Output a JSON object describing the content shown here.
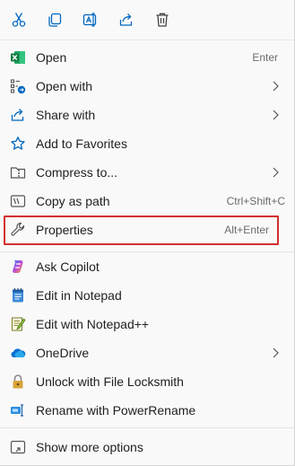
{
  "toolbar": {
    "cut_icon": "scissors-icon",
    "copy_icon": "copy-icon",
    "rename_icon": "rename-icon",
    "share_icon": "share-icon",
    "delete_icon": "trash-icon"
  },
  "items": [
    {
      "label": "Open",
      "shortcut": "Enter",
      "icon": "excel-icon"
    },
    {
      "label": "Open with",
      "shortcut": "",
      "icon": "open-with-icon",
      "submenu": true
    },
    {
      "label": "Share with",
      "shortcut": "",
      "icon": "share-with-icon",
      "submenu": true
    },
    {
      "label": "Add to Favorites",
      "shortcut": "",
      "icon": "star-icon"
    },
    {
      "label": "Compress to...",
      "shortcut": "",
      "icon": "zip-folder-icon",
      "submenu": true
    },
    {
      "label": "Copy as path",
      "shortcut": "Ctrl+Shift+C",
      "icon": "path-icon"
    },
    {
      "label": "Properties",
      "shortcut": "Alt+Enter",
      "icon": "wrench-icon",
      "highlighted": true
    },
    {
      "label": "Ask Copilot",
      "shortcut": "",
      "icon": "copilot-icon"
    },
    {
      "label": "Edit in Notepad",
      "shortcut": "",
      "icon": "notepad-icon"
    },
    {
      "label": "Edit with Notepad++",
      "shortcut": "",
      "icon": "notepadpp-icon"
    },
    {
      "label": "OneDrive",
      "shortcut": "",
      "icon": "onedrive-icon",
      "submenu": true
    },
    {
      "label": "Unlock with File Locksmith",
      "shortcut": "",
      "icon": "lock-icon"
    },
    {
      "label": "Rename with PowerRename",
      "shortcut": "",
      "icon": "powerrename-icon"
    },
    {
      "label": "Show more options",
      "shortcut": "",
      "icon": "more-options-icon"
    }
  ],
  "colors": {
    "accent": "#0067c0",
    "highlight_border": "#d32f2f",
    "excel_green": "#107c41"
  }
}
